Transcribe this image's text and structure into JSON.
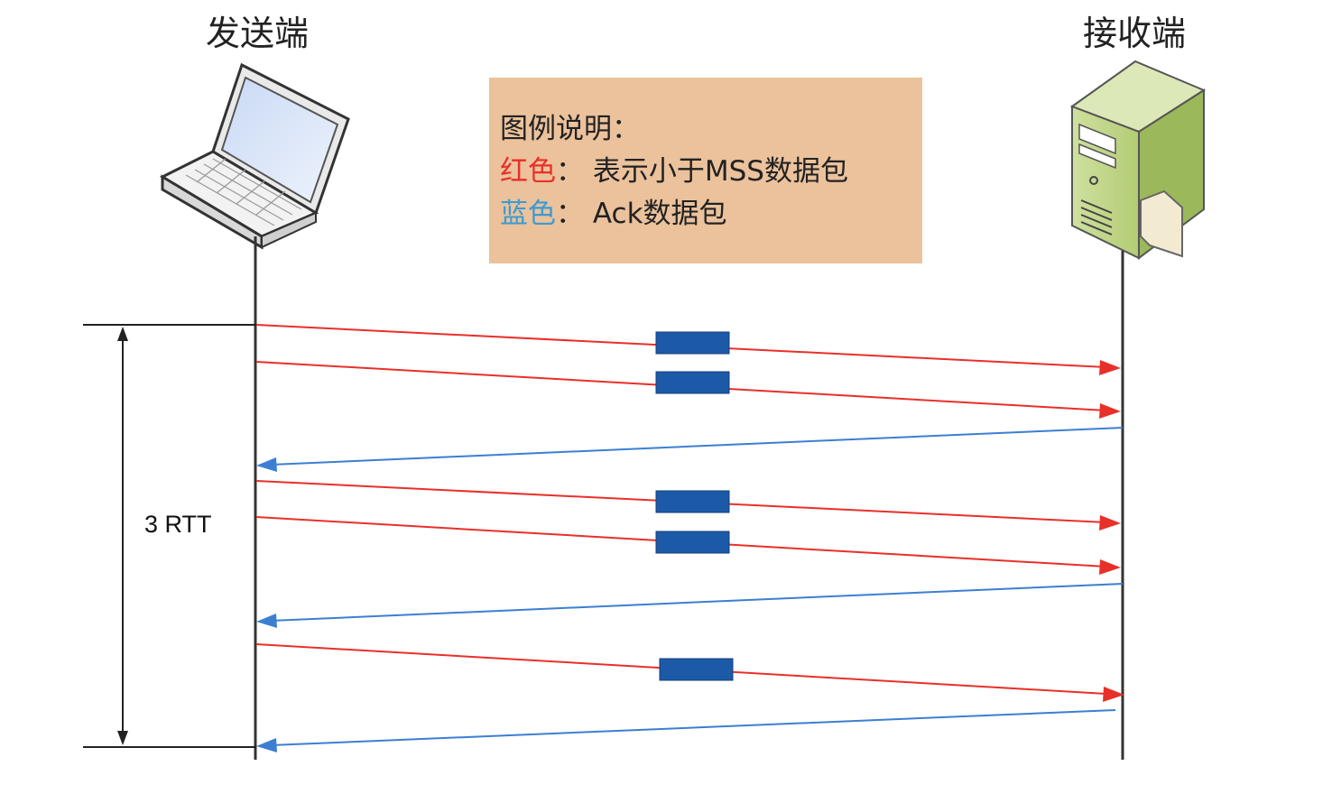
{
  "sender": {
    "label": "发送端",
    "icon": "laptop-icon"
  },
  "receiver": {
    "label": "接收端",
    "icon": "server-icon"
  },
  "legend": {
    "title": "图例说明：",
    "red": {
      "key": "红色",
      "sep": "：",
      "desc": "表示小于MSS数据包",
      "color": "#e8302a"
    },
    "blue": {
      "key": "蓝色",
      "sep": "：",
      "desc": "Ack数据包",
      "color": "#3c7fd2"
    }
  },
  "rtt_label": "3 RTT",
  "colors": {
    "red": "#e8302a",
    "blue": "#3c7fd2",
    "packet": "#1c5aa8",
    "lifeline": "#333333"
  },
  "messages": [
    {
      "kind": "data",
      "dir": "to-receiver"
    },
    {
      "kind": "data",
      "dir": "to-receiver"
    },
    {
      "kind": "ack",
      "dir": "to-sender"
    },
    {
      "kind": "data",
      "dir": "to-receiver"
    },
    {
      "kind": "data",
      "dir": "to-receiver"
    },
    {
      "kind": "ack",
      "dir": "to-sender"
    },
    {
      "kind": "data",
      "dir": "to-receiver"
    },
    {
      "kind": "ack",
      "dir": "to-sender"
    }
  ]
}
